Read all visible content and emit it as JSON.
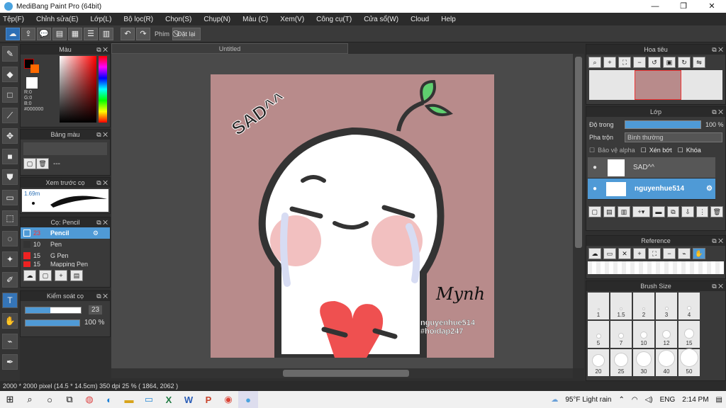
{
  "window": {
    "title": "MediBang Paint Pro (64bit)",
    "min": "—",
    "max": "❐",
    "close": "✕"
  },
  "menu": [
    "Tệp(F)",
    "Chỉnh sửa(E)",
    "Lớp(L)",
    "Bộ lọc(R)",
    "Chọn(S)",
    "Chụp(N)",
    "Màu (C)",
    "Xem(V)",
    "Công cụ(T)",
    "Cửa sổ(W)",
    "Cloud",
    "Help"
  ],
  "toolbar": {
    "shortcut_label": "Phím",
    "reset_label": "Đặt lại"
  },
  "document_tab": "Untitled",
  "canvas_text": {
    "sad": "SAD^^",
    "signature": "Mynh",
    "watermark1": "nguyenhue514",
    "watermark2": "#hoidap247"
  },
  "color_panel": {
    "title": "Màu",
    "r": "R:0",
    "g": "G:0",
    "b": "B:0",
    "hex": "#000000"
  },
  "palette_panel": {
    "title": "Bảng màu",
    "name": "---"
  },
  "brush_preview": {
    "title": "Xem trước cọ",
    "size": "1.69m"
  },
  "brush_list": {
    "title": "Cọ: Pencil",
    "items": [
      {
        "size": "23",
        "name": "Pencil"
      },
      {
        "size": "10",
        "name": "Pen"
      },
      {
        "size": "15",
        "name": "G Pen"
      },
      {
        "size": "15",
        "name": "Mapping Pen"
      }
    ]
  },
  "brush_control": {
    "title": "Kiểm soát cọ",
    "size": "23",
    "opacity": "100 %"
  },
  "navigator": {
    "title": "Hoa tiêu"
  },
  "layer_panel": {
    "title": "Lớp",
    "opacity_label": "Độ trong",
    "opacity": "100 %",
    "blend_label": "Pha trộn",
    "blend": "Bình thường",
    "protect_alpha": "Bảo vệ alpha",
    "clip": "Xén bớt",
    "lock": "Khóa",
    "layers": [
      {
        "name": "SAD^^"
      },
      {
        "name": "nguyenhue514"
      }
    ]
  },
  "reference_panel": {
    "title": "Reference"
  },
  "brush_size_panel": {
    "title": "Brush Size",
    "sizes": [
      "1",
      "1.5",
      "2",
      "3",
      "4",
      "5",
      "7",
      "10",
      "12",
      "15",
      "20",
      "25",
      "30",
      "40",
      "50"
    ]
  },
  "status": "2000 * 2000 pixel   (14.5 * 14.5cm)   350 dpi   25 %   ( 1864, 2062 )",
  "taskbar": {
    "weather": "95°F  Light rain",
    "lang": "ENG",
    "time": "2:14 PM"
  },
  "colors": {
    "accent": "#4f9ad6",
    "canvas_bg": "#b88b8b",
    "fg_color": "#000000",
    "bg_color": "#ff6a00"
  }
}
